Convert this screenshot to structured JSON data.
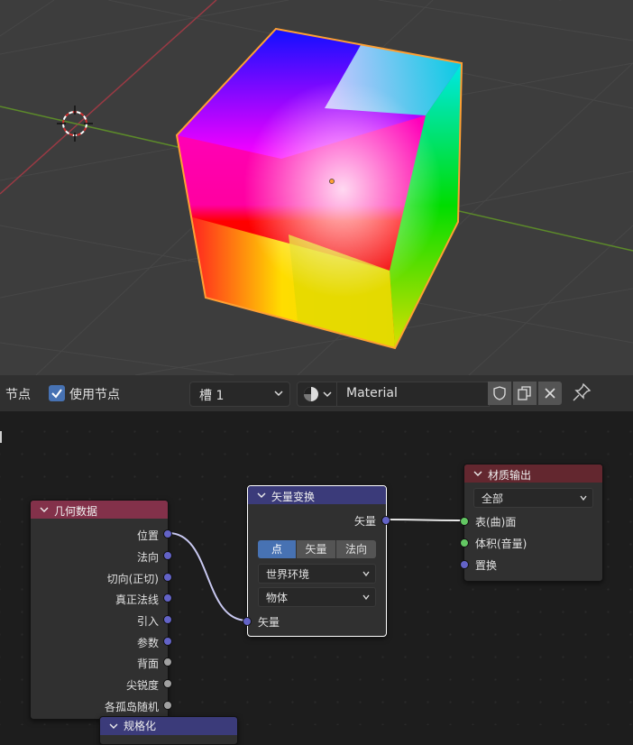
{
  "header": {
    "nodes_menu": "节点",
    "use_nodes_label": "使用节点",
    "slot": "槽 1",
    "material_name": "Material"
  },
  "nodes": {
    "geometry": {
      "title": "几何数据",
      "outputs": [
        "位置",
        "法向",
        "切向(正切)",
        "真正法线",
        "引入",
        "参数",
        "背面",
        "尖锐度",
        "各孤岛随机"
      ]
    },
    "vector_transform": {
      "title": "矢量变换",
      "output": "矢量",
      "modes": [
        "点",
        "矢量",
        "法向"
      ],
      "active_mode": "点",
      "convert_from": "世界环境",
      "convert_to": "物体",
      "input": "矢量"
    },
    "material_output": {
      "title": "材质输出",
      "target": "全部",
      "inputs": [
        "表(曲)面",
        "体积(音量)",
        "置换"
      ]
    },
    "partial_node": {
      "title": "规格化"
    }
  },
  "colors": {
    "accent": "#4772b3",
    "vector_socket": "#6363c7",
    "shader_socket": "#63c763",
    "float_socket": "#a1a1a1",
    "input_header": "#83314a",
    "vector_header": "#3b3b7a",
    "output_header": "#63272f",
    "selection_outline": "#ffa033"
  }
}
